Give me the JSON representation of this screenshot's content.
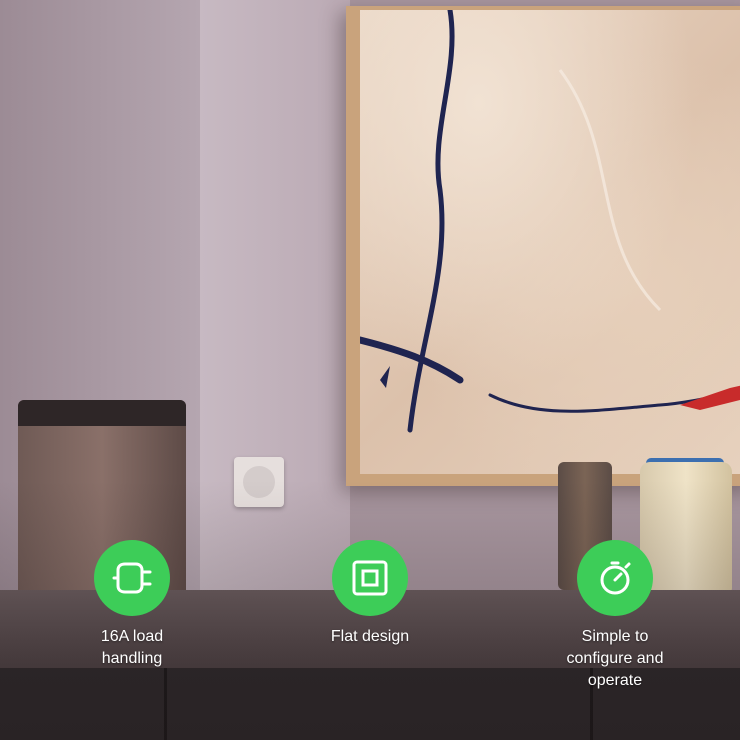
{
  "features": [
    {
      "icon": "plug-icon",
      "label": "16A load\nhandling"
    },
    {
      "icon": "square-frame-icon",
      "label": "Flat design"
    },
    {
      "icon": "stopwatch-icon",
      "label": "Simple to\nconfigure and\noperate"
    }
  ],
  "colors": {
    "accent": "#3dcd58",
    "text": "#ffffff"
  }
}
